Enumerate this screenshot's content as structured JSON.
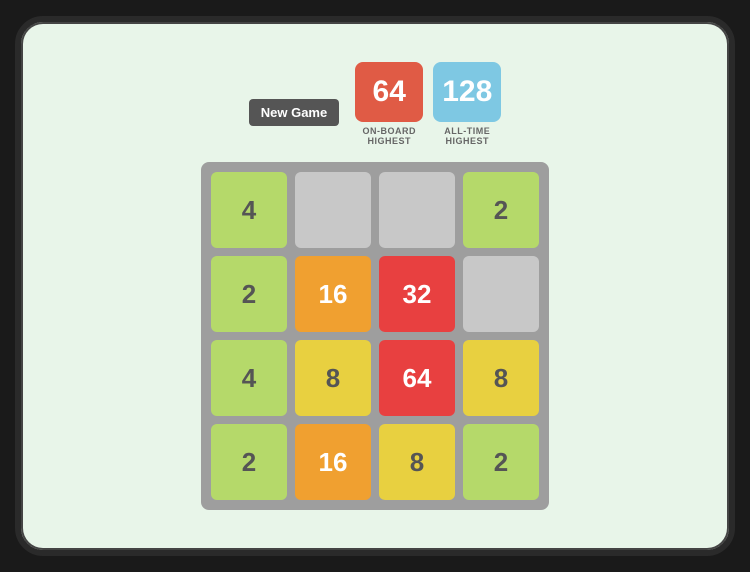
{
  "header": {
    "new_game_label": "New Game",
    "on_board_score": "64",
    "on_board_label": "ON-BOARD\nHIGHEST",
    "all_time_score": "128",
    "all_time_label": "ALL-TIME\nHIGHEST"
  },
  "grid": {
    "rows": [
      [
        {
          "value": "4",
          "type": "green"
        },
        {
          "value": "",
          "type": "empty"
        },
        {
          "value": "",
          "type": "empty"
        },
        {
          "value": "2",
          "type": "green"
        }
      ],
      [
        {
          "value": "2",
          "type": "green"
        },
        {
          "value": "16",
          "type": "orange"
        },
        {
          "value": "32",
          "type": "red"
        },
        {
          "value": "",
          "type": "empty"
        }
      ],
      [
        {
          "value": "4",
          "type": "green"
        },
        {
          "value": "8",
          "type": "yellow"
        },
        {
          "value": "64",
          "type": "red"
        },
        {
          "value": "8",
          "type": "yellow"
        }
      ],
      [
        {
          "value": "2",
          "type": "green"
        },
        {
          "value": "16",
          "type": "orange"
        },
        {
          "value": "8",
          "type": "yellow"
        },
        {
          "value": "2",
          "type": "green"
        }
      ]
    ]
  }
}
